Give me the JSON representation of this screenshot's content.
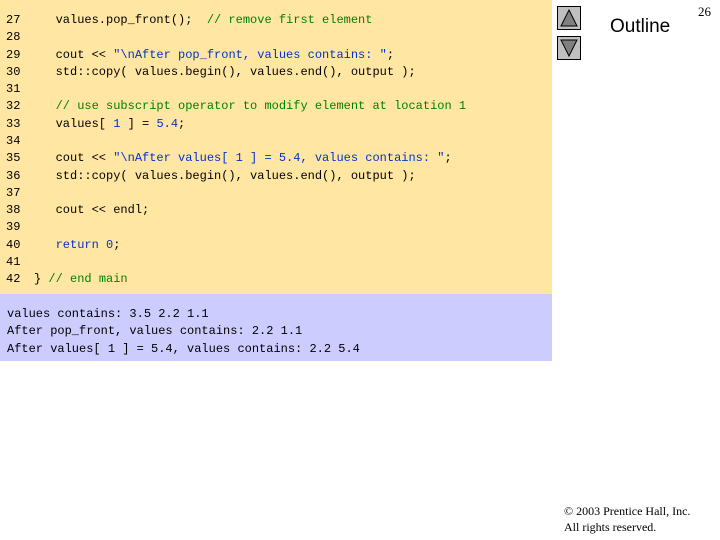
{
  "slide": {
    "page_number": "26",
    "outline_label": "Outline",
    "copyright_line1": "© 2003 Prentice Hall, Inc.",
    "copyright_line2": "All rights reserved."
  },
  "nav": {
    "up_icon": "triangle-up",
    "down_icon": "triangle-down"
  },
  "code": {
    "lines": [
      {
        "num": "27",
        "a": "   values.pop_front();  ",
        "b": "// remove first element"
      },
      {
        "num": "28"
      },
      {
        "num": "29",
        "a": "   cout << ",
        "b": "\"\\nAfter pop_front, values contains: \"",
        "c": ";"
      },
      {
        "num": "30",
        "a": "   std::copy( values.begin(), values.end(), output );"
      },
      {
        "num": "31"
      },
      {
        "num": "32",
        "a": "   ",
        "b": "// use subscript operator to modify element at location 1"
      },
      {
        "num": "33",
        "a": "   values[ ",
        "b": "1",
        "c": " ] = ",
        "d": "5.4",
        "e": ";"
      },
      {
        "num": "34"
      },
      {
        "num": "35",
        "a": "   cout << ",
        "b": "\"\\nAfter values[ 1 ] = 5.4, values contains: \"",
        "c": ";"
      },
      {
        "num": "36",
        "a": "   std::copy( values.begin(), values.end(), output );"
      },
      {
        "num": "37"
      },
      {
        "num": "38",
        "a": "   cout << endl;"
      },
      {
        "num": "39"
      },
      {
        "num": "40",
        "a": "   ",
        "b": "return",
        "c": " ",
        "d": "0",
        "e": ";"
      },
      {
        "num": "41"
      },
      {
        "num": "42",
        "a": "} ",
        "b": "// end main"
      }
    ]
  },
  "output": {
    "lines": [
      "values contains: 3.5 2.2 1.1",
      "After pop_front, values contains: 2.2 1.1",
      "After values[ 1 ] = 5.4, values contains: 2.2 5.4"
    ]
  },
  "colors": {
    "code_background": "#ffe6a3",
    "output_background": "#ccccff",
    "keyword": "#0033cc",
    "comment": "#008000"
  }
}
